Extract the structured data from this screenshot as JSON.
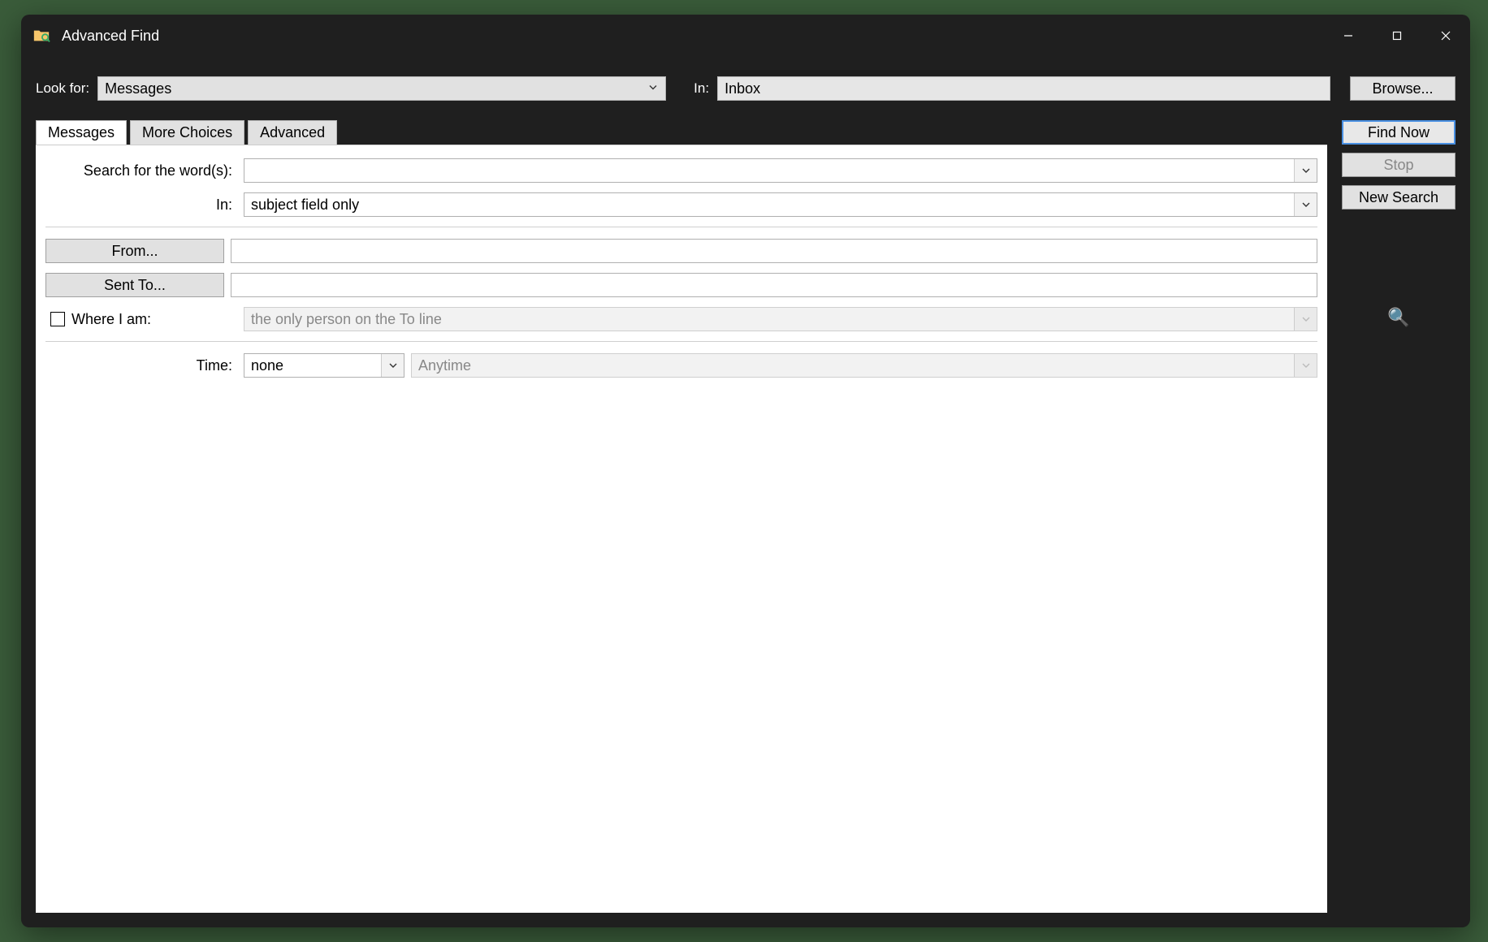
{
  "window": {
    "title": "Advanced Find"
  },
  "top": {
    "look_for_label": "Look for:",
    "look_for_value": "Messages",
    "in_label": "In:",
    "in_value": "Inbox",
    "browse_label": "Browse..."
  },
  "tabs": {
    "messages": "Messages",
    "more_choices": "More Choices",
    "advanced": "Advanced",
    "active": "messages"
  },
  "right": {
    "find_now": "Find Now",
    "stop": "Stop",
    "new_search": "New Search",
    "magnifier_icon": "🔍"
  },
  "form": {
    "search_words_label": "Search for the word(s):",
    "search_words_value": "",
    "in_label": "In:",
    "in_value": "subject field only",
    "from_label": "From...",
    "from_value": "",
    "sent_to_label": "Sent To...",
    "sent_to_value": "",
    "where_i_am_label": "Where I am:",
    "where_i_am_checked": false,
    "where_i_am_value": "the only person on the To line",
    "time_label": "Time:",
    "time_type": "none",
    "time_range": "Anytime"
  }
}
